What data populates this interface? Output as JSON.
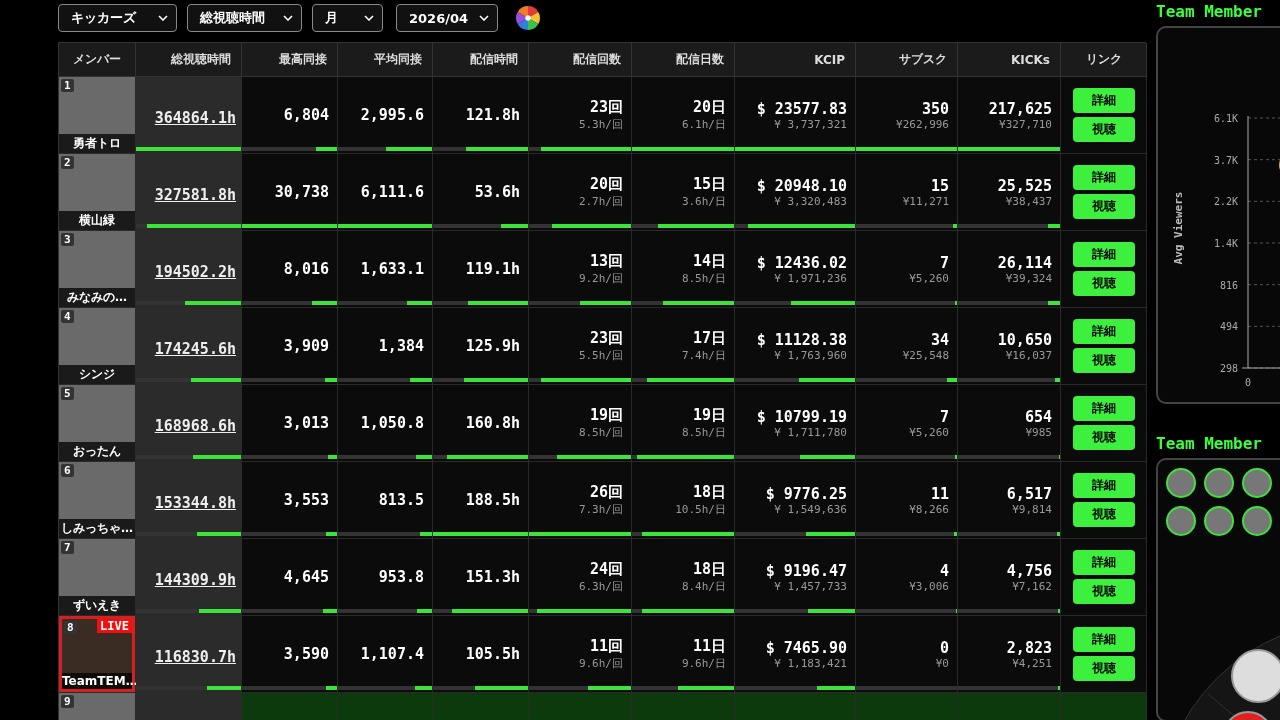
{
  "filters": [
    {
      "value": "キッカーズ"
    },
    {
      "value": "総視聴時間"
    },
    {
      "value": "月"
    },
    {
      "value": "2026/04"
    }
  ],
  "table": {
    "columns": [
      {
        "label": "メンバー"
      },
      {
        "label": "総視聴時間"
      },
      {
        "label": "最高同接"
      },
      {
        "label": "平均同接"
      },
      {
        "label": "配信時間"
      },
      {
        "label": "配信回数"
      },
      {
        "label": "配信日数"
      },
      {
        "label": "KCIP"
      },
      {
        "label": "サブスク"
      },
      {
        "label": "KICKs"
      },
      {
        "label": "リンク"
      }
    ],
    "rows": [
      {
        "rank": "1",
        "name": "勇者トロ",
        "live": false,
        "highlighted": false,
        "total": {
          "text": "364864.1h",
          "level": 1
        },
        "metrics": [
          {
            "main": "6,804",
            "level": 0.22
          },
          {
            "main": "2,995.6",
            "level": 0.49
          },
          {
            "main": "121.8h",
            "level": 0.65
          },
          {
            "main": "23回",
            "sub": "5.3h/回",
            "level": 0.88
          },
          {
            "main": "20日",
            "sub": "6.1h/日",
            "level": 1
          },
          {
            "main": "$ 23577.83",
            "sub": "¥ 3,737,321",
            "level": 1
          },
          {
            "main": "350",
            "sub": "¥262,996",
            "level": 1
          },
          {
            "main": "217,625",
            "sub": "¥327,710",
            "level": 1
          }
        ],
        "buttons": [
          "詳細",
          "視聴"
        ]
      },
      {
        "rank": "2",
        "name": "横山緑",
        "live": false,
        "highlighted": false,
        "total": {
          "text": "327581.8h",
          "level": 0.9
        },
        "metrics": [
          {
            "main": "30,738",
            "level": 1
          },
          {
            "main": "6,111.6",
            "level": 1
          },
          {
            "main": "53.6h",
            "level": 0.28
          },
          {
            "main": "20回",
            "sub": "2.7h/回",
            "level": 0.77
          },
          {
            "main": "15日",
            "sub": "3.6h/日",
            "level": 0.75
          },
          {
            "main": "$ 20948.10",
            "sub": "¥ 3,320,483",
            "level": 0.89
          },
          {
            "main": "15",
            "sub": "¥11,271",
            "level": 0.04
          },
          {
            "main": "25,525",
            "sub": "¥38,437",
            "level": 0.12
          }
        ],
        "buttons": [
          "詳細",
          "視聴"
        ]
      },
      {
        "rank": "3",
        "name": "みなみの…",
        "live": false,
        "highlighted": false,
        "total": {
          "text": "194502.2h",
          "level": 0.53
        },
        "metrics": [
          {
            "main": "8,016",
            "level": 0.26
          },
          {
            "main": "1,633.1",
            "level": 0.27
          },
          {
            "main": "119.1h",
            "level": 0.63
          },
          {
            "main": "13回",
            "sub": "9.2h/回",
            "level": 0.5
          },
          {
            "main": "14日",
            "sub": "8.5h/日",
            "level": 0.7
          },
          {
            "main": "$ 12436.02",
            "sub": "¥ 1,971,236",
            "level": 0.53
          },
          {
            "main": "7",
            "sub": "¥5,260",
            "level": 0.02
          },
          {
            "main": "26,114",
            "sub": "¥39,324",
            "level": 0.12
          }
        ],
        "buttons": [
          "詳細",
          "視聴"
        ]
      },
      {
        "rank": "4",
        "name": "シンジ",
        "live": false,
        "highlighted": false,
        "total": {
          "text": "174245.6h",
          "level": 0.48
        },
        "metrics": [
          {
            "main": "3,909",
            "level": 0.13
          },
          {
            "main": "1,384",
            "level": 0.23
          },
          {
            "main": "125.9h",
            "level": 0.67
          },
          {
            "main": "23回",
            "sub": "5.5h/回",
            "level": 0.88
          },
          {
            "main": "17日",
            "sub": "7.4h/日",
            "level": 0.85
          },
          {
            "main": "$ 11128.38",
            "sub": "¥ 1,763,960",
            "level": 0.47
          },
          {
            "main": "34",
            "sub": "¥25,548",
            "level": 0.1
          },
          {
            "main": "10,650",
            "sub": "¥16,037",
            "level": 0.05
          }
        ],
        "buttons": [
          "詳細",
          "視聴"
        ]
      },
      {
        "rank": "5",
        "name": "おったん",
        "live": false,
        "highlighted": false,
        "total": {
          "text": "168968.6h",
          "level": 0.46
        },
        "metrics": [
          {
            "main": "3,013",
            "level": 0.1
          },
          {
            "main": "1,050.8",
            "level": 0.17
          },
          {
            "main": "160.8h",
            "level": 0.85
          },
          {
            "main": "19回",
            "sub": "8.5h/回",
            "level": 0.73
          },
          {
            "main": "19日",
            "sub": "8.5h/日",
            "level": 0.95
          },
          {
            "main": "$ 10799.19",
            "sub": "¥ 1,711,780",
            "level": 0.46
          },
          {
            "main": "7",
            "sub": "¥5,260",
            "level": 0.02
          },
          {
            "main": "654",
            "sub": "¥985",
            "level": 0.01
          }
        ],
        "buttons": [
          "詳細",
          "視聴"
        ]
      },
      {
        "rank": "6",
        "name": "しみっちゃ…",
        "live": false,
        "highlighted": false,
        "total": {
          "text": "153344.8h",
          "level": 0.42
        },
        "metrics": [
          {
            "main": "3,553",
            "level": 0.12
          },
          {
            "main": "813.5",
            "level": 0.13
          },
          {
            "main": "188.5h",
            "level": 1
          },
          {
            "main": "26回",
            "sub": "7.3h/回",
            "level": 1
          },
          {
            "main": "18日",
            "sub": "10.5h/日",
            "level": 0.9
          },
          {
            "main": "$ 9776.25",
            "sub": "¥ 1,549,636",
            "level": 0.41
          },
          {
            "main": "11",
            "sub": "¥8,266",
            "level": 0.03
          },
          {
            "main": "6,517",
            "sub": "¥9,814",
            "level": 0.03
          }
        ],
        "buttons": [
          "詳細",
          "視聴"
        ]
      },
      {
        "rank": "7",
        "name": "ずいえき",
        "live": false,
        "highlighted": false,
        "total": {
          "text": "144309.9h",
          "level": 0.4
        },
        "metrics": [
          {
            "main": "4,645",
            "level": 0.15
          },
          {
            "main": "953.8",
            "level": 0.16
          },
          {
            "main": "151.3h",
            "level": 0.8
          },
          {
            "main": "24回",
            "sub": "6.3h/回",
            "level": 0.92
          },
          {
            "main": "18日",
            "sub": "8.4h/日",
            "level": 0.9
          },
          {
            "main": "$ 9196.47",
            "sub": "¥ 1,457,733",
            "level": 0.39
          },
          {
            "main": "4",
            "sub": "¥3,006",
            "level": 0.01
          },
          {
            "main": "4,756",
            "sub": "¥7,162",
            "level": 0.02
          }
        ],
        "buttons": [
          "詳細",
          "視聴"
        ]
      },
      {
        "rank": "8",
        "name": "TeamTEM…",
        "live": true,
        "highlighted": false,
        "total": {
          "text": "116830.7h",
          "level": 0.32
        },
        "metrics": [
          {
            "main": "3,590",
            "level": 0.12
          },
          {
            "main": "1,107.4",
            "level": 0.18
          },
          {
            "main": "105.5h",
            "level": 0.56
          },
          {
            "main": "11回",
            "sub": "9.6h/回",
            "level": 0.42
          },
          {
            "main": "11日",
            "sub": "9.6h/日",
            "level": 0.55
          },
          {
            "main": "$ 7465.90",
            "sub": "¥ 1,183,421",
            "level": 0.32
          },
          {
            "main": "0",
            "sub": "¥0",
            "level": 0
          },
          {
            "main": "2,823",
            "sub": "¥4,251",
            "level": 0.02
          }
        ],
        "buttons": [
          "詳細",
          "視聴"
        ]
      },
      {
        "rank": "9",
        "live": false,
        "highlighted": true
      }
    ]
  },
  "live_badge": "LIVE",
  "chart_panel": {
    "title": "Team Member",
    "y_axis_label": "Avg Viewers",
    "y_ticks": [
      "6.1K",
      "3.7K",
      "2.2K",
      "1.4K",
      "816",
      "494",
      "298"
    ],
    "x_ticks": [
      "0"
    ]
  },
  "members_panel": {
    "title": "Team Member",
    "avatars": [
      {
        "live": true
      },
      {
        "live": true
      },
      {
        "live": true
      },
      {
        "live": true
      },
      {
        "live": true
      },
      {
        "live": true
      }
    ]
  }
}
